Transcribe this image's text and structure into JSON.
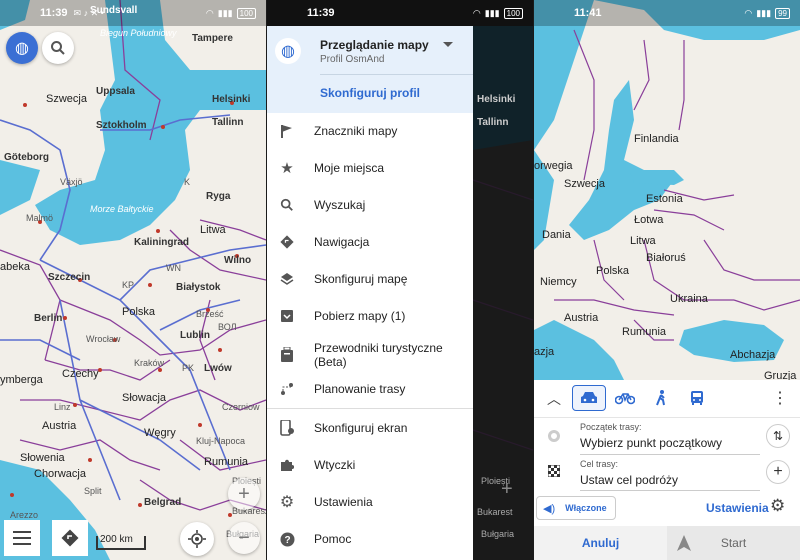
{
  "phone1": {
    "status": {
      "time": "11:39"
    },
    "labels": {
      "biegun": "Biegun Południowy",
      "tampere": "Tampere",
      "sundsvall": "Sundsvall",
      "szwecja": "Szwecja",
      "uppsala": "Uppsala",
      "helsinki": "Helsinki",
      "sztokholm": "Sztokholm",
      "tallinn": "Tallinn",
      "goteborg": "Göteborg",
      "vaxjo": "Växjö",
      "k": "K",
      "ryga": "Ryga",
      "morze": "Morze Bałtyckie",
      "malmo": "Malmö",
      "kaliningrad": "Kaliningrad",
      "litwa": "Litwa",
      "abeka": "abeka",
      "szczecin": "Szczecin",
      "wn": "WN",
      "wilno": "Wilno",
      "kp": "KP",
      "bialystok": "Białystok",
      "berlin": "Berlin",
      "polska": "Polska",
      "brzesc": "Brześć",
      "wroclaw": "Wrocław",
      "lublin": "Lublin",
      "bol": "ВОЛ",
      "czechy": "Czechy",
      "krakow": "Kraków",
      "pk": "PK",
      "lwow": "Lwów",
      "ymberga": "ymberga",
      "slowacja": "Słowacja",
      "linz": "Linz",
      "austria": "Austria",
      "wegry": "Węgry",
      "czerniow": "Czerniow",
      "kluj": "Kluj-Napoca",
      "slowenia": "Słowenia",
      "chorwacja": "Chorwacja",
      "rumunia": "Rumunia",
      "split": "Split",
      "belgrad": "Belgrad",
      "bukareszt": "Bukareszt",
      "arezzo": "Arezzo",
      "ploiesti": "Ploiești",
      "bulgaria": "Bułgaria"
    },
    "scale": "200 km"
  },
  "drawer": {
    "status": {
      "time": "11:39"
    },
    "profile_title": "Przeglądanie mapy",
    "profile_sub": "Profil OsmAnd",
    "configure_profile": "Skonfiguruj profil",
    "items": [
      {
        "label": "Znaczniki mapy",
        "icon": "flag-icon"
      },
      {
        "label": "Moje miejsca",
        "icon": "star-icon"
      },
      {
        "label": "Wyszukaj",
        "icon": "search-icon"
      },
      {
        "label": "Nawigacja",
        "icon": "navigation-icon"
      },
      {
        "label": "Skonfiguruj mapę",
        "icon": "layers-icon"
      },
      {
        "label": "Pobierz mapy (1)",
        "icon": "download-icon"
      },
      {
        "label": "Przewodniki turystyczne (Beta)",
        "icon": "luggage-icon"
      },
      {
        "label": "Planowanie trasy",
        "icon": "route-planning-icon"
      },
      {
        "label": "Skonfiguruj ekran",
        "icon": "configure-screen-icon"
      },
      {
        "label": "Wtyczki",
        "icon": "puzzle-icon"
      },
      {
        "label": "Ustawienia",
        "icon": "gear-icon"
      },
      {
        "label": "Pomoc",
        "icon": "help-icon"
      }
    ],
    "bg_labels": {
      "helsinki": "Helsinki",
      "tallinn": "Tallinn",
      "ploiesti": "Ploiești",
      "bukarest": "Bukarest",
      "bulgaria": "Bułgaria",
      "plus": "+"
    }
  },
  "phone3": {
    "status": {
      "time": "11:41"
    },
    "labels": {
      "finlandia": "Finlandia",
      "szwecja": "Szwecja",
      "orwegia": "orwegia",
      "estonia": "Estonia",
      "lotwa": "Łotwa",
      "litwa": "Litwa",
      "dania": "Dania",
      "bialorus": "Białoruś",
      "polska": "Polska",
      "niemcy": "Niemcy",
      "ukraina": "Ukraina",
      "austria": "Austria",
      "rumunia": "Rumunia",
      "abchazja": "Abchazja",
      "azja": "azja",
      "gruzja": "Gruzja"
    },
    "route": {
      "start_label": "Początek trasy:",
      "start_value": "Wybierz punkt początkowy",
      "end_label": "Cel trasy:",
      "end_value": "Ustaw cel podróży",
      "voice": "Włączone",
      "settings": "Ustawienia",
      "cancel": "Anuluj",
      "start": "Start"
    }
  },
  "colors": {
    "accent": "#2f6ad0",
    "water": "#5bc0e0",
    "land": "#f2efe9",
    "border": "#8a3f9a",
    "road": "#5a6ed0"
  }
}
